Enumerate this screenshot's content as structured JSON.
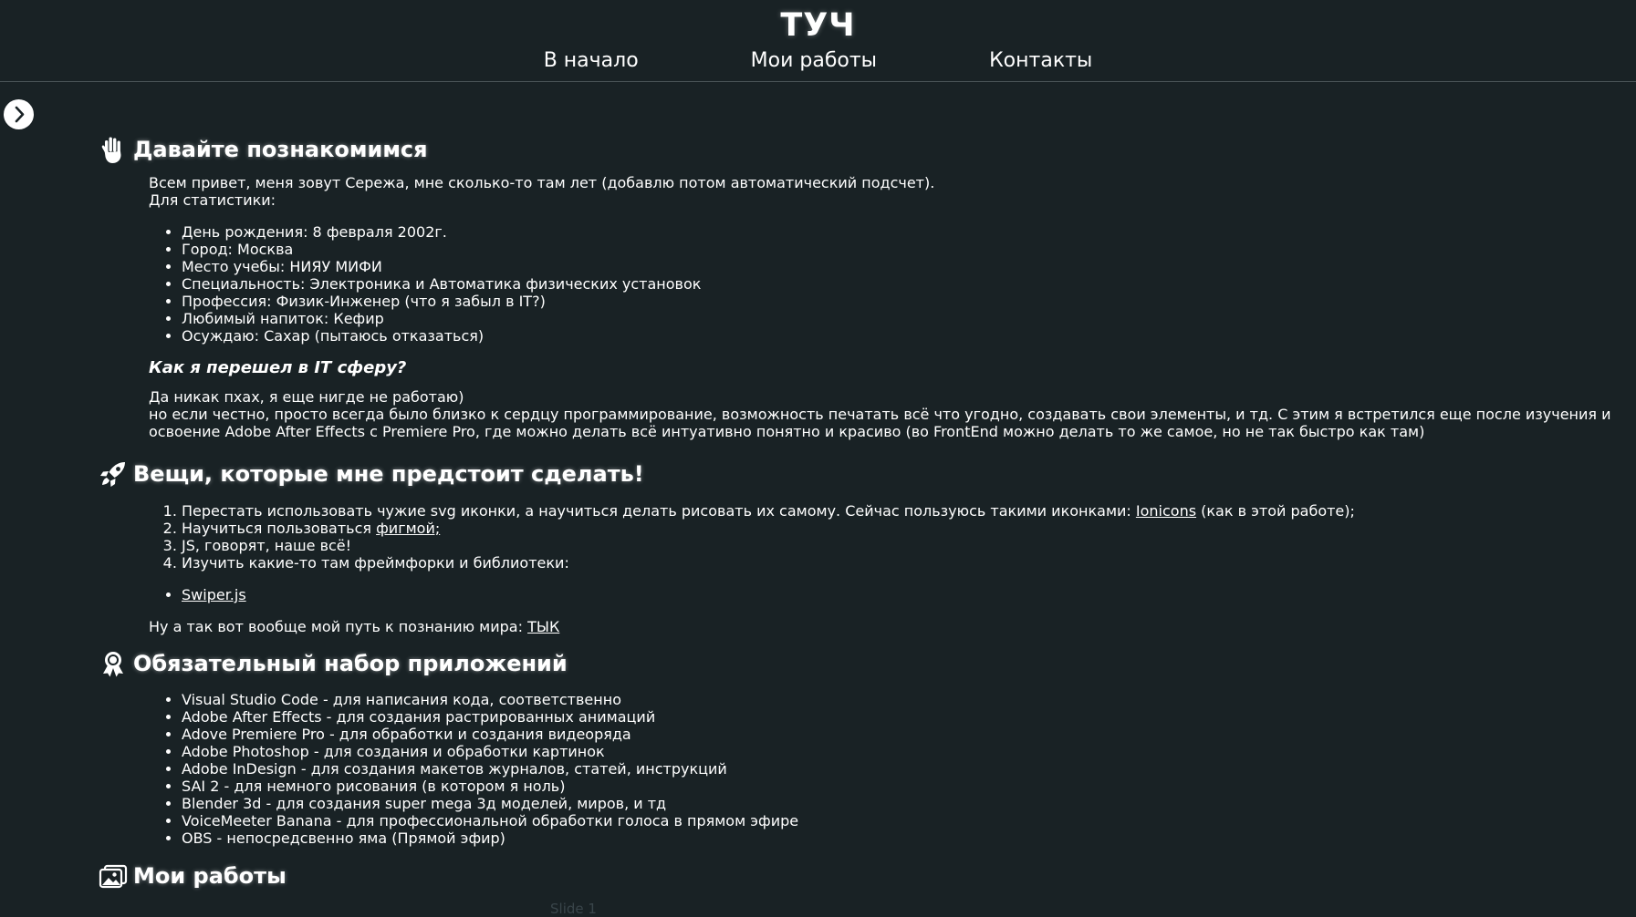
{
  "header": {
    "brand": "ТУЧ",
    "nav": [
      "В начало",
      "Мои работы",
      "Контакты"
    ]
  },
  "about": {
    "title": "Давайте познакомимся",
    "intro_line1": "Всем привет, меня зовут Сережа, мне сколько-то там лет (добавлю потом автоматический подсчет).",
    "intro_line2": "Для статистики:",
    "stats": [
      "День рождения: 8 февраля 2002г.",
      "Город: Москва",
      "Место учебы: НИЯУ МИФИ",
      "Специальность: Электроника и Автоматика физических установок",
      "Профессия: Физик-Инженер (что я забыл в IT?)",
      "Любимый напиток: Кефир",
      "Осуждаю: Сахар (пытаюсь отказаться)"
    ],
    "subtitle": "Как я перешел в IT сферу?",
    "story_line1": "Да никак пхах, я еще нигде не работаю)",
    "story_line2": "но если честно, просто всегда было близко к сердцу программирование, возможность печатать всё что угодно, создавать свои элементы, и тд. С этим я встретился еще после изучения и",
    "story_line3": "освоение Adobe After Effects с Premiere Pro, где можно делать всё интуативно понятно и красиво (во FrontEnd можно делать то же самое, но не так быстро как там)"
  },
  "todo": {
    "title": "Вещи, которые мне предстоит сделать!",
    "item1_text": "Перестать использовать чужие svg иконки, а научиться делать рисовать их самому. Сейчас пользуюсь такими иконками: ",
    "item1_link": "Ionicons",
    "item1_tail": " (как в этой работе);",
    "item2_text": "Научиться пользоваться ",
    "item2_link": "фигмой;",
    "item3": "JS, говорят, наше всё!",
    "item4": "Изучить какие-то там фреймфорки и библиотеки:",
    "libs": [
      "Swiper.js"
    ],
    "path_text": "Ну а так вот вообще мой путь к познанию мира: ",
    "path_link": "ТЫК"
  },
  "apps": {
    "title": "Обязательный набор приложений",
    "items": [
      "Visual Studio Code - для написания кода, соответственно",
      "Adobe After Effects - для создания растрированных анимаций",
      "Adove Premiere Pro - для обработки и создания видеоряда",
      "Adobe Photoshop - для создания и обработки картинок",
      "Adobe InDesign - для создания макетов журналов, статей, инструкций",
      "SAI 2 - для немного рисования (в котором я ноль)",
      "Blender 3d - для создания super mega 3д моделей, миров, и тд",
      "VoiceMeeter Banana - для профессиональной обработки голоса в прямом эфире",
      "OBS - непосредсвенно яма (Прямой эфир)"
    ]
  },
  "works": {
    "title": "Мои работы",
    "slide_label": "Slide 1"
  },
  "icons": {
    "toggle": "chevron-forward-icon",
    "about": "hand-icon",
    "todo": "rocket-icon",
    "apps": "ribbon-icon",
    "works": "images-icon"
  },
  "colors": {
    "background": "#192225",
    "text": "#ffffff",
    "divider": "#4a5558"
  }
}
